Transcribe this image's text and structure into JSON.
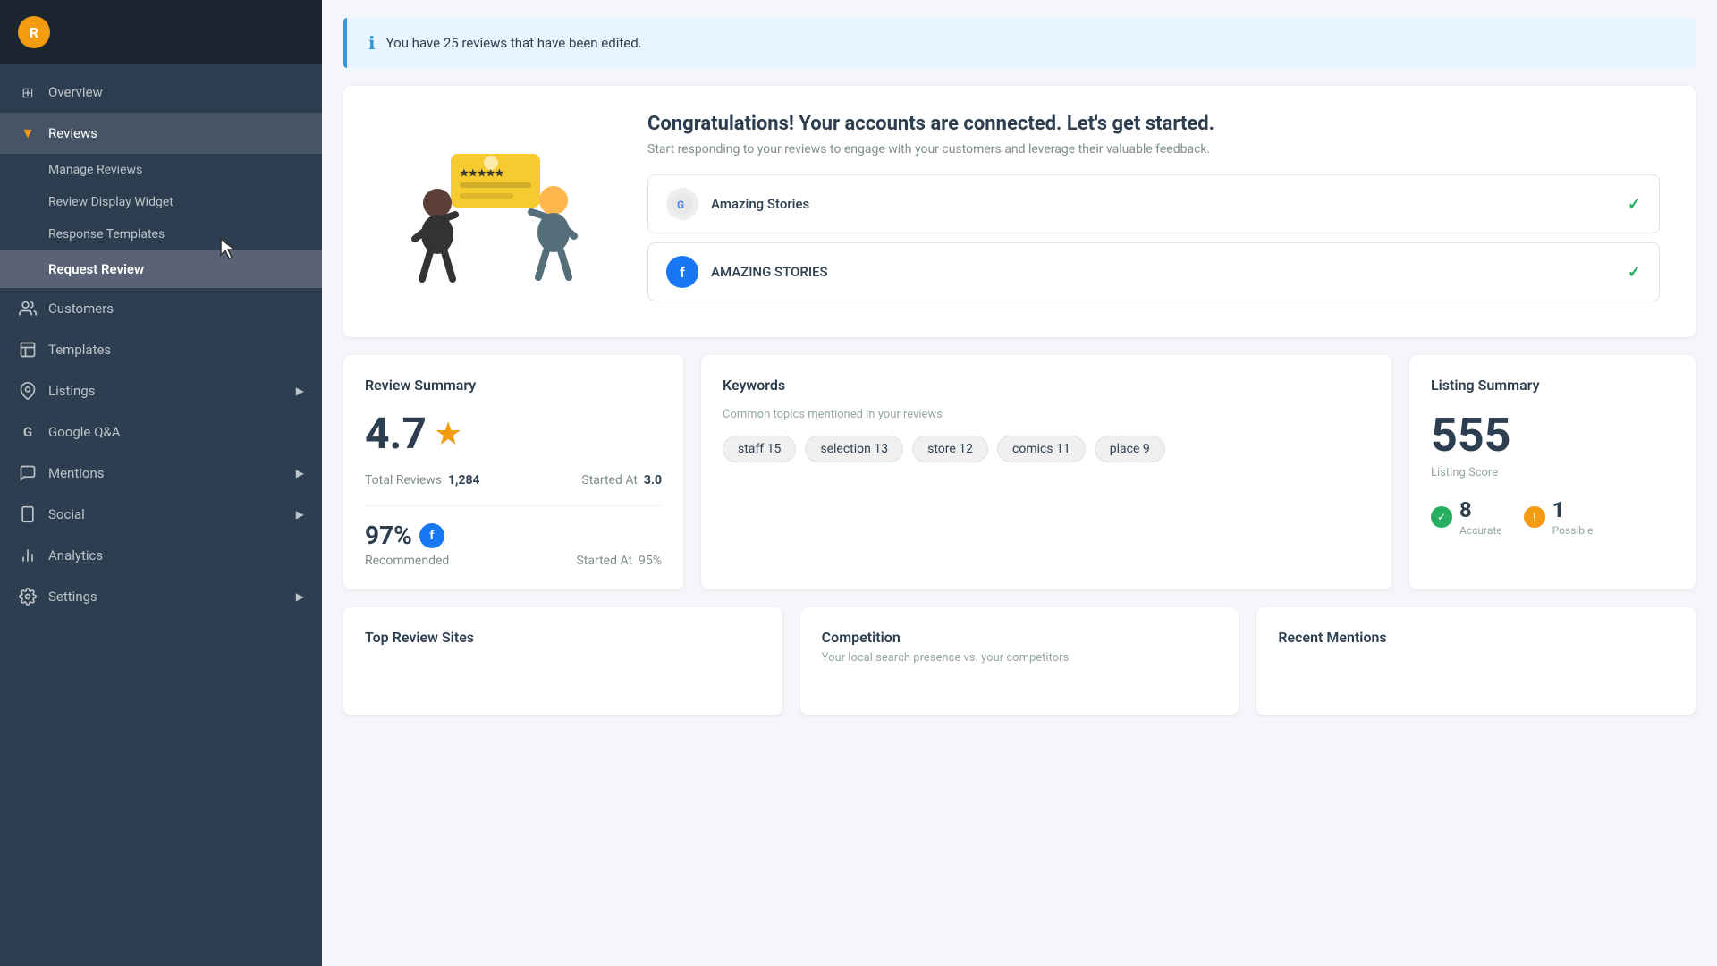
{
  "sidebar": {
    "logo_letter": "R",
    "items": [
      {
        "id": "overview",
        "label": "Overview",
        "icon": "⊞",
        "active": false,
        "expandable": false
      },
      {
        "id": "reviews",
        "label": "Reviews",
        "icon": "★",
        "active": true,
        "expandable": true,
        "expanded": true
      },
      {
        "id": "customers",
        "label": "Customers",
        "icon": "👥",
        "active": false,
        "expandable": false
      },
      {
        "id": "templates",
        "label": "Templates",
        "icon": "☰",
        "active": false,
        "expandable": false
      },
      {
        "id": "listings",
        "label": "Listings",
        "icon": "📍",
        "active": false,
        "expandable": true
      },
      {
        "id": "google-qa",
        "label": "Google Q&A",
        "icon": "G",
        "active": false,
        "expandable": false
      },
      {
        "id": "mentions",
        "label": "Mentions",
        "icon": "💬",
        "active": false,
        "expandable": true
      },
      {
        "id": "social",
        "label": "Social",
        "icon": "📱",
        "active": false,
        "expandable": true
      },
      {
        "id": "analytics",
        "label": "Analytics",
        "icon": "📊",
        "active": false,
        "expandable": false
      },
      {
        "id": "settings",
        "label": "Settings",
        "icon": "⚙",
        "active": false,
        "expandable": true
      }
    ],
    "sub_items": [
      {
        "id": "manage-reviews",
        "label": "Manage Reviews",
        "active": false
      },
      {
        "id": "review-display-widget",
        "label": "Review Display Widget",
        "active": false
      },
      {
        "id": "response-templates",
        "label": "Response Templates",
        "active": false
      },
      {
        "id": "request-review",
        "label": "Request Review",
        "active": true
      }
    ]
  },
  "banner": {
    "message": "You have 25 reviews that have been edited."
  },
  "connected": {
    "title": "Congratulations! Your accounts are connected. Let's get started.",
    "subtitle": "Start responding to your reviews to engage with your customers and leverage their valuable feedback.",
    "accounts": [
      {
        "id": "amazing-stories",
        "name": "Amazing Stories",
        "type": "google"
      },
      {
        "id": "amazing-stories-fb",
        "name": "AMAZING STORIES",
        "type": "facebook"
      }
    ]
  },
  "review_summary": {
    "title": "Review Summary",
    "rating": "4.7",
    "star": "★",
    "total_reviews_label": "Total Reviews",
    "total_reviews_value": "1,284",
    "started_at_label": "Started At",
    "started_at_value": "3.0",
    "recommended_pct": "97%",
    "recommended_label": "Recommended",
    "started_at_pct_label": "Started At",
    "started_at_pct_value": "95%"
  },
  "keywords": {
    "title": "Keywords",
    "subtitle": "Common topics mentioned in your reviews",
    "tags": [
      {
        "label": "staff 15"
      },
      {
        "label": "selection 13"
      },
      {
        "label": "store 12"
      },
      {
        "label": "comics 11"
      },
      {
        "label": "place 9"
      }
    ]
  },
  "listing_summary": {
    "title": "Listing Summary",
    "score": "555",
    "score_label": "Listing Score",
    "accurate_count": "8",
    "accurate_label": "Accurate",
    "possible_label": "Possible",
    "possible_count": "1"
  },
  "bottom_cards": [
    {
      "id": "top-review-sites",
      "title": "Top Review Sites"
    },
    {
      "id": "competition",
      "title": "Competition",
      "subtitle": "Your local search presence vs. your competitors"
    },
    {
      "id": "recent-mentions",
      "title": "Recent Mentions"
    }
  ]
}
